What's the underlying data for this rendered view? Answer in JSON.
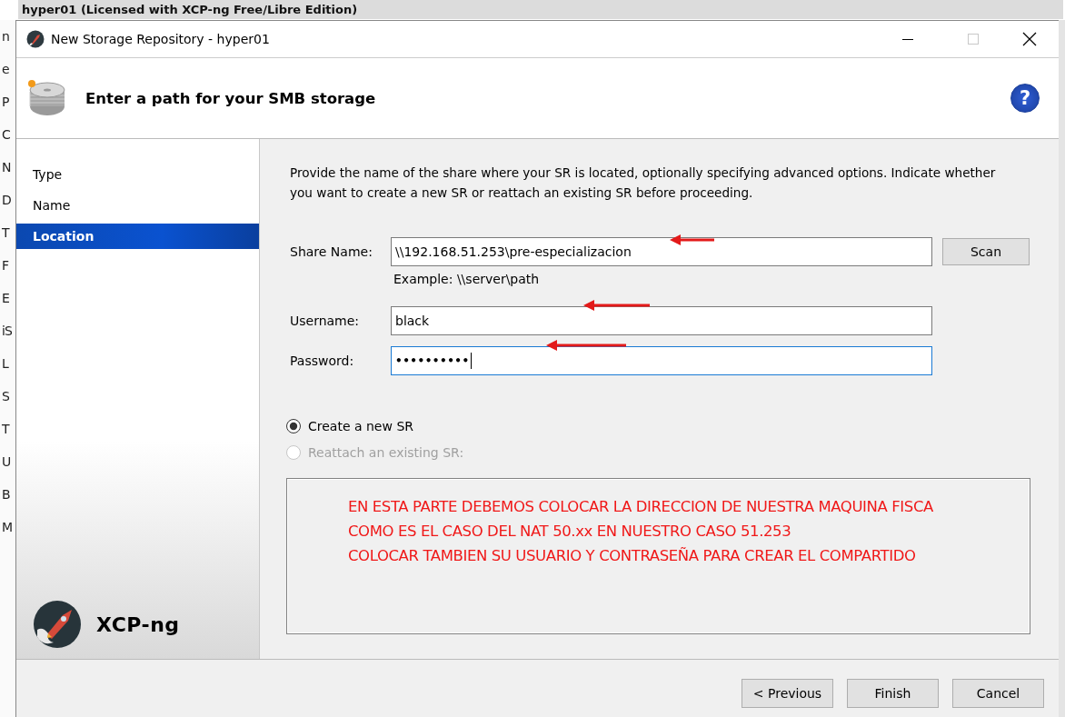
{
  "background_window": {
    "title": "hyper01    (Licensed with XCP-ng Free/Libre Edition)",
    "edge_letters": [
      "n",
      "e",
      "P",
      "C",
      "N",
      "D",
      "T",
      "F",
      "E",
      "iS",
      "L",
      "S",
      "T",
      "U",
      "B",
      "M"
    ]
  },
  "window": {
    "title": "New Storage Repository - hyper01",
    "maximize_disabled": true
  },
  "header": {
    "title": "Enter a path for your SMB storage",
    "help": "?"
  },
  "steps": [
    {
      "label": "Type",
      "selected": false
    },
    {
      "label": "Name",
      "selected": false
    },
    {
      "label": "Location",
      "selected": true
    }
  ],
  "brand": {
    "name": "XCP-ng"
  },
  "description": "Provide the name of the share where your SR is located, optionally specifying advanced options. Indicate whether you want to create a new SR or reattach an existing SR before proceeding.",
  "fields": [
    {
      "label": "Share Name:",
      "value": "\\\\192.168.51.253\\pre-especializacion",
      "kind": "text",
      "focused": false,
      "hint": "Example: \\\\server\\path",
      "button": "Scan"
    },
    {
      "label": "Username:",
      "value": "black",
      "kind": "text",
      "focused": false
    },
    {
      "label": "Password:",
      "value": "••••••••••",
      "kind": "password",
      "focused": true
    }
  ],
  "options": [
    {
      "label": "Create a new SR",
      "selected": true,
      "disabled": false
    },
    {
      "label": "Reattach an existing SR:",
      "selected": false,
      "disabled": true
    }
  ],
  "annotation_note": [
    "EN ESTA PARTE DEBEMOS COLOCAR LA DIRECCION DE NUESTRA MAQUINA FISCA",
    "COMO ES EL CASO DEL NAT 50.xx EN NUESTRO CASO 51.253",
    "COLOCAR TAMBIEN SU USUARIO Y CONTRASEÑA PARA CREAR EL COMPARTIDO"
  ],
  "buttons": [
    {
      "label": "< Previous"
    },
    {
      "label": "Finish"
    },
    {
      "label": "Cancel"
    }
  ]
}
